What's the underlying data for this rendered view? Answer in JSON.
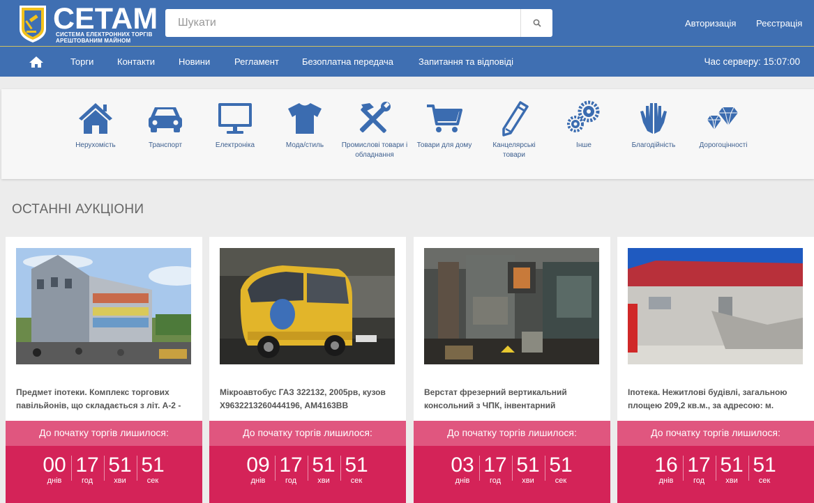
{
  "header": {
    "logo_title": "СЕТАМ",
    "logo_subtitle_1": "СИСТЕМА ЕЛЕКТРОННИХ ТОРГІВ",
    "logo_subtitle_2": "АРЕШТОВАНИМ МАЙНОМ",
    "search_placeholder": "Шукати",
    "login": "Авторизація",
    "register": "Реєстрація"
  },
  "nav": {
    "items": [
      "Торги",
      "Контакти",
      "Новини",
      "Регламент",
      "Безоплатна передача",
      "Запитання та відповіді"
    ],
    "server_time": "Час серверу: 15:07:00"
  },
  "categories": [
    {
      "label": "Нерухомість",
      "icon": "house-icon"
    },
    {
      "label": "Транспорт",
      "icon": "car-icon"
    },
    {
      "label": "Електроніка",
      "icon": "monitor-icon"
    },
    {
      "label": "Мода/стиль",
      "icon": "tshirt-icon"
    },
    {
      "label": "Промислові товари і обладнання",
      "icon": "tools-icon"
    },
    {
      "label": "Товари для дому",
      "icon": "cart-icon"
    },
    {
      "label": "Канцелярські товари",
      "icon": "pencil-icon"
    },
    {
      "label": "Інше",
      "icon": "gears-icon"
    },
    {
      "label": "Благодійність",
      "icon": "hands-icon"
    },
    {
      "label": "Дорогоцінності",
      "icon": "diamond-icon"
    }
  ],
  "section_title": "ОСТАННІ АУКЦІОНИ",
  "auctions": [
    {
      "title": "Предмет іпотеки. Комплекс торгових павільйонів, що складається з літ. А-2 -",
      "band": "До початку торгів лишилося:",
      "days": "00",
      "hours": "17",
      "minutes": "51",
      "seconds": "51",
      "days_label": "днів",
      "hours_label": "год",
      "minutes_label": "хви",
      "seconds_label": "сек"
    },
    {
      "title": "Мікроавтобус ГАЗ 322132, 2005рв, кузов Х9632213260444196, АМ4163ВВ",
      "band": "До початку торгів лишилося:",
      "days": "09",
      "hours": "17",
      "minutes": "51",
      "seconds": "51",
      "days_label": "днів",
      "hours_label": "год",
      "minutes_label": "хви",
      "seconds_label": "сек"
    },
    {
      "title": "Верстат фрезерний вертикальний консольний з ЧПК, інвентарний",
      "band": "До початку торгів лишилося:",
      "days": "03",
      "hours": "17",
      "minutes": "51",
      "seconds": "51",
      "days_label": "днів",
      "hours_label": "год",
      "minutes_label": "хви",
      "seconds_label": "сек"
    },
    {
      "title": "Іпотека. Нежитлові будівлі, загальною площею 209,2 кв.м., за адресою: м.",
      "band": "До початку торгів лишилося:",
      "days": "16",
      "hours": "17",
      "minutes": "51",
      "seconds": "51",
      "days_label": "днів",
      "hours_label": "год",
      "minutes_label": "хви",
      "seconds_label": "сек"
    }
  ],
  "colors": {
    "brand_blue": "#3f6fb2",
    "icon_blue": "#3b6cb0",
    "timer_red": "#d42358",
    "timer_band": "#e0567f"
  }
}
